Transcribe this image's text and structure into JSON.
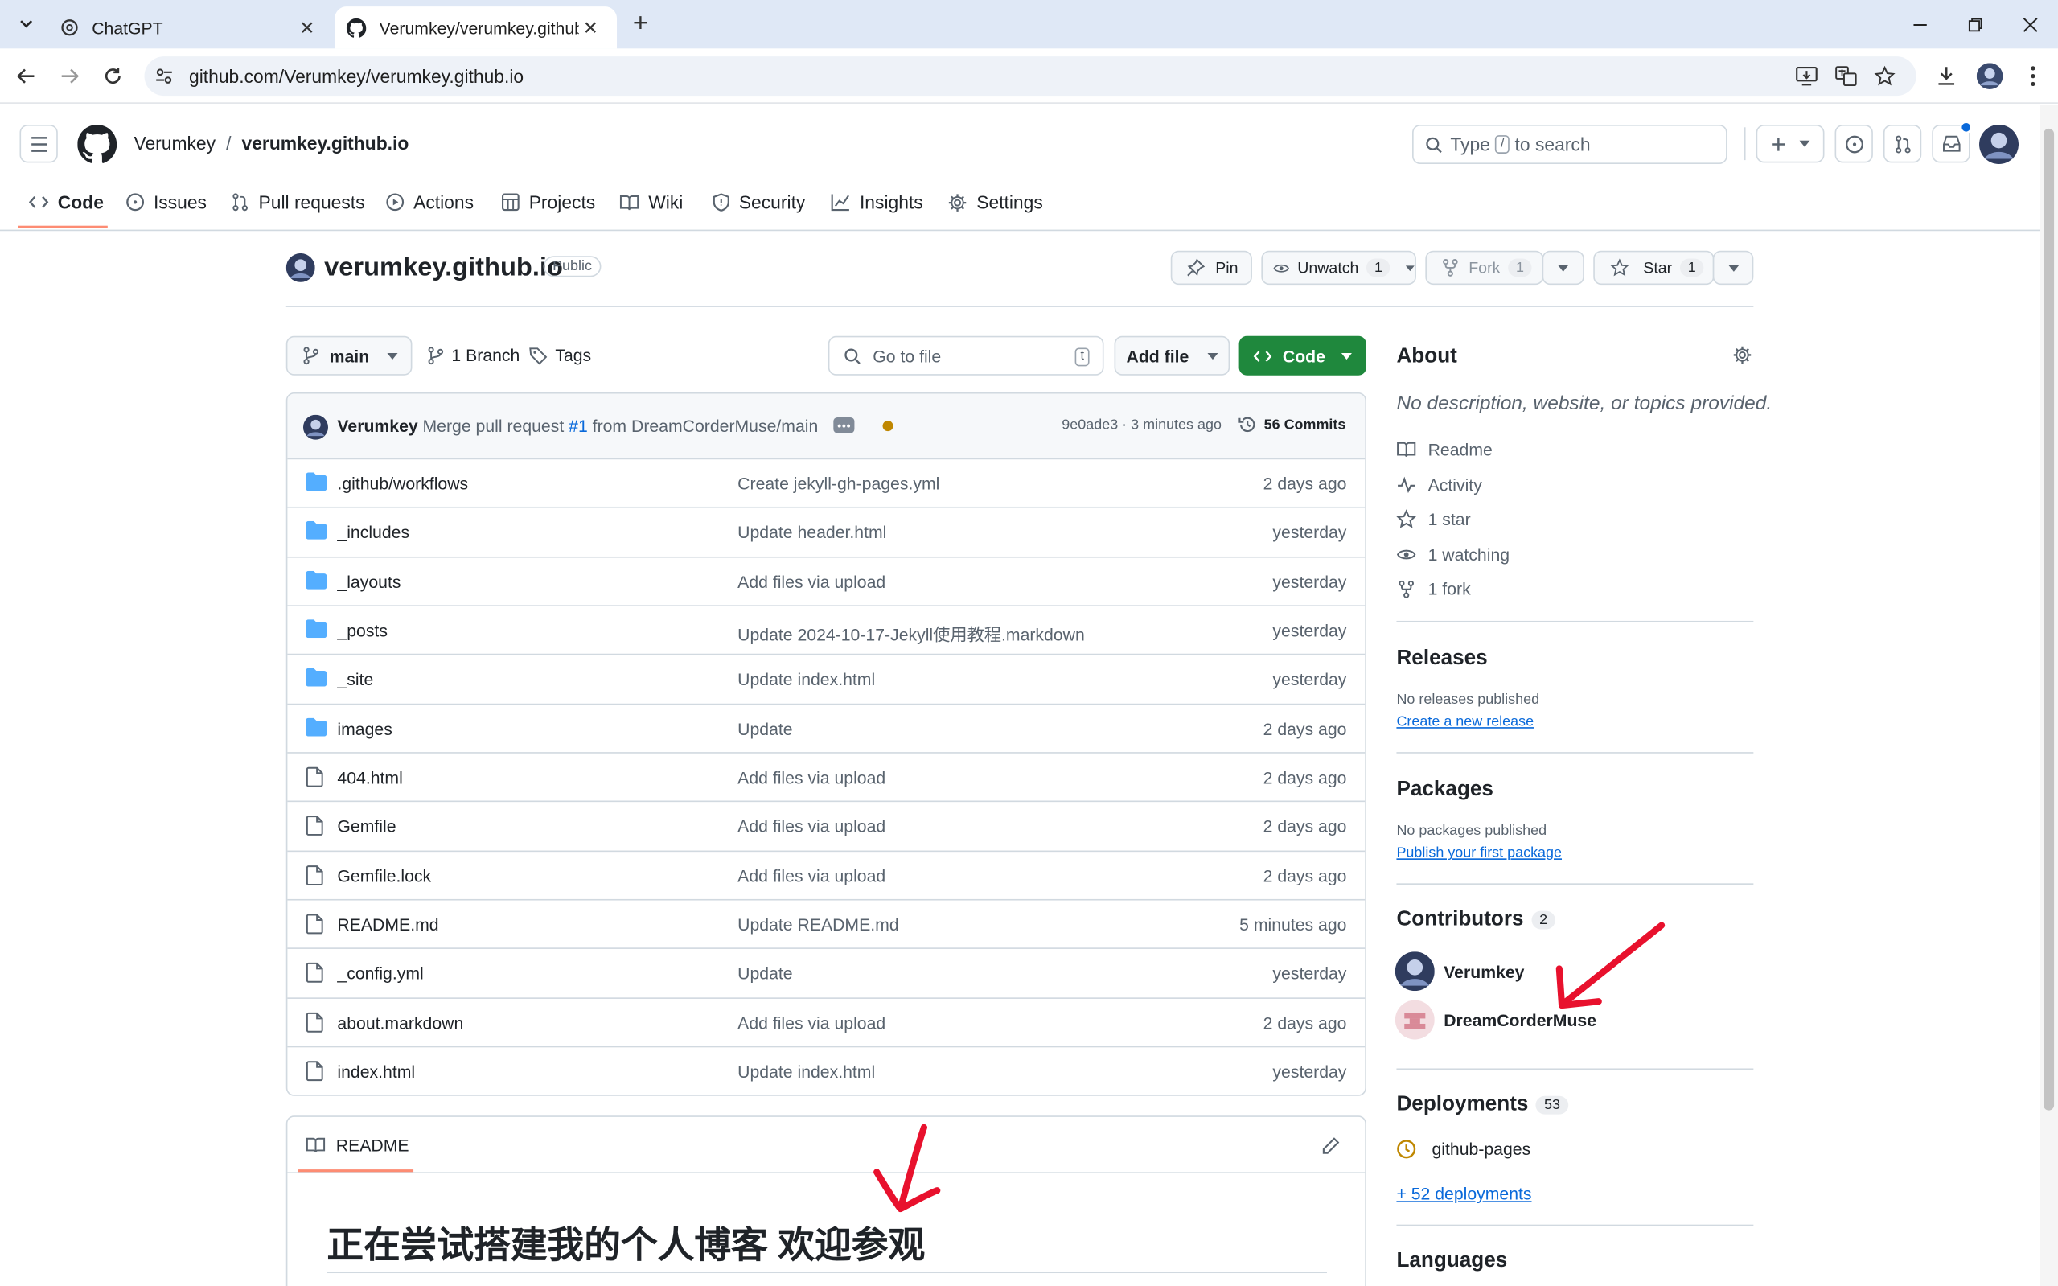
{
  "browser": {
    "tabs": [
      {
        "title": "ChatGPT",
        "icon": "chatgpt-icon"
      },
      {
        "title": "Verumkey/verumkey.github.io",
        "icon": "github-icon"
      }
    ],
    "url": "github.com/Verumkey/verumkey.github.io"
  },
  "header": {
    "owner": "Verumkey",
    "separator": "/",
    "repo": "verumkey.github.io",
    "search_placeholder_pre": "Type",
    "search_key": "/",
    "search_placeholder_post": "to search"
  },
  "repo_nav": [
    {
      "label": "Code",
      "icon": "code-icon"
    },
    {
      "label": "Issues",
      "icon": "issue-icon"
    },
    {
      "label": "Pull requests",
      "icon": "pull-request-icon"
    },
    {
      "label": "Actions",
      "icon": "play-icon"
    },
    {
      "label": "Projects",
      "icon": "table-icon"
    },
    {
      "label": "Wiki",
      "icon": "book-icon"
    },
    {
      "label": "Security",
      "icon": "shield-icon"
    },
    {
      "label": "Insights",
      "icon": "graph-icon"
    },
    {
      "label": "Settings",
      "icon": "gear-icon"
    }
  ],
  "repo_header": {
    "name": "verumkey.github.io",
    "visibility": "Public",
    "pin": "Pin",
    "unwatch": "Unwatch",
    "unwatch_count": "1",
    "fork": "Fork",
    "fork_count": "1",
    "star": "Star",
    "star_count": "1"
  },
  "file_nav": {
    "branch": "main",
    "branches": "1 Branch",
    "tags": "Tags",
    "goto_placeholder": "Go to file",
    "goto_key": "t",
    "add_file": "Add file",
    "code": "Code"
  },
  "commit": {
    "author": "Verumkey",
    "msg_pre": "Merge pull request",
    "pr": "#1",
    "msg_post": "from DreamCorderMuse/main",
    "hash": "9e0ade3",
    "dot": "·",
    "time": "3 minutes ago",
    "commits": "56 Commits"
  },
  "files": [
    {
      "name": ".github/workflows",
      "type": "dir",
      "message": "Create jekyll-gh-pages.yml",
      "date": "2 days ago"
    },
    {
      "name": "_includes",
      "type": "dir",
      "message": "Update header.html",
      "date": "yesterday"
    },
    {
      "name": "_layouts",
      "type": "dir",
      "message": "Add files via upload",
      "date": "yesterday"
    },
    {
      "name": "_posts",
      "type": "dir",
      "message": "Update 2024-10-17-Jekyll使用教程.markdown",
      "date": "yesterday"
    },
    {
      "name": "_site",
      "type": "dir",
      "message": "Update index.html",
      "date": "yesterday"
    },
    {
      "name": "images",
      "type": "dir",
      "message": "Update",
      "date": "2 days ago"
    },
    {
      "name": "404.html",
      "type": "file",
      "message": "Add files via upload",
      "date": "2 days ago"
    },
    {
      "name": "Gemfile",
      "type": "file",
      "message": "Add files via upload",
      "date": "2 days ago"
    },
    {
      "name": "Gemfile.lock",
      "type": "file",
      "message": "Add files via upload",
      "date": "2 days ago"
    },
    {
      "name": "README.md",
      "type": "file",
      "message": "Update README.md",
      "date": "5 minutes ago"
    },
    {
      "name": "_config.yml",
      "type": "file",
      "message": "Update",
      "date": "yesterday"
    },
    {
      "name": "about.markdown",
      "type": "file",
      "message": "Add files via upload",
      "date": "2 days ago"
    },
    {
      "name": "index.html",
      "type": "file",
      "message": "Update index.html",
      "date": "yesterday"
    }
  ],
  "readme": {
    "tab": "README",
    "heading": "正在尝试搭建我的个人博客 欢迎参观"
  },
  "about": {
    "title": "About",
    "description": "No description, website, or topics provided.",
    "items": [
      {
        "label": "Readme",
        "icon": "book-icon"
      },
      {
        "label": "Activity",
        "icon": "pulse-icon"
      },
      {
        "label": "1 star",
        "icon": "star-icon"
      },
      {
        "label": "1 watching",
        "icon": "eye-icon"
      },
      {
        "label": "1 fork",
        "icon": "fork-icon"
      }
    ]
  },
  "releases": {
    "title": "Releases",
    "none": "No releases published",
    "link": "Create a new release"
  },
  "packages": {
    "title": "Packages",
    "none": "No packages published",
    "link": "Publish your first package"
  },
  "contributors": {
    "title": "Contributors",
    "count": "2",
    "list": [
      {
        "name": "Verumkey"
      },
      {
        "name": "DreamCorderMuse"
      }
    ]
  },
  "deployments": {
    "title": "Deployments",
    "count": "53",
    "env": "github-pages",
    "more": "+ 52 deployments"
  },
  "languages": {
    "title": "Languages"
  },
  "colors": {
    "accent_green": "#1f883d",
    "link_blue": "#0969da",
    "folder_blue": "#54aeff",
    "annotation_red": "#e8112d",
    "nav_underline": "#fd8c73"
  }
}
